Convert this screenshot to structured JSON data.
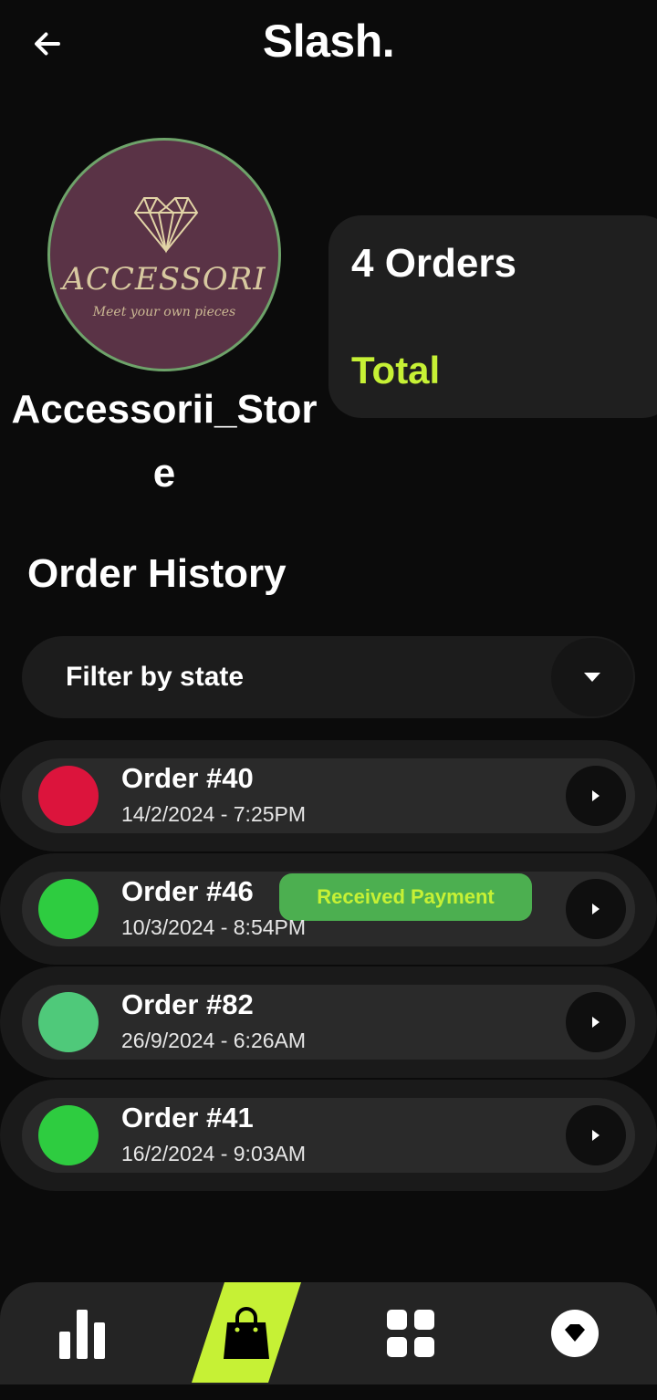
{
  "header": {
    "title": "Slash.",
    "back_icon": "arrow-left-icon"
  },
  "store": {
    "logo_brand": "ACCESSORI",
    "logo_tagline": "Meet your own pieces",
    "name": "Accessorii_Store"
  },
  "orders_card": {
    "count_text": "4 Orders",
    "total_label": "Total"
  },
  "order_history": {
    "title": "Order History",
    "filter_label": "Filter by state",
    "orders": [
      {
        "number": "Order #40",
        "date": "14/2/2024 - 7:25PM",
        "status_color": "#dc143c",
        "badge": ""
      },
      {
        "number": "Order #46",
        "date": "10/3/2024 - 8:54PM",
        "status_color": "#2ecc40",
        "badge": "Received Payment"
      },
      {
        "number": "Order #82",
        "date": "26/9/2024 - 6:26AM",
        "status_color": "#4fc97a",
        "badge": ""
      },
      {
        "number": "Order #41",
        "date": "16/2/2024 - 9:03AM",
        "status_color": "#2ecc40",
        "badge": ""
      }
    ]
  },
  "bottom_nav": {
    "items": [
      "bar-chart-icon",
      "shopping-bag-icon",
      "grid-icon",
      "diamond-icon"
    ],
    "active_color": "#c6f135"
  }
}
